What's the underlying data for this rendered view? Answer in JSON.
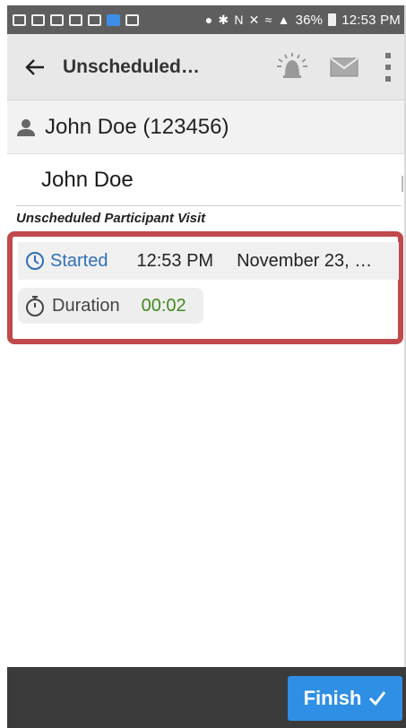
{
  "status_bar": {
    "battery": "36%",
    "time": "12:53 PM"
  },
  "app_bar": {
    "title": "Unscheduled…",
    "back_icon": "arrow-left-icon",
    "alarm_icon": "alarm-bell-icon",
    "mail_icon": "envelope-icon",
    "menu_icon": "more-vert-icon"
  },
  "participant": {
    "header": "John Doe (123456)",
    "name_value": "John Doe"
  },
  "visit": {
    "label": "Unscheduled Participant Visit",
    "started_label": "Started",
    "started_time": "12:53 PM",
    "started_date": "November 23, 2…",
    "duration_label": "Duration",
    "duration_value": "00:02"
  },
  "footer": {
    "finish_label": "Finish"
  },
  "colors": {
    "accent_blue": "#2f8fe5",
    "started_blue": "#2f6fb8",
    "duration_green": "#3f8a1f",
    "highlight_red": "#c0494c"
  }
}
